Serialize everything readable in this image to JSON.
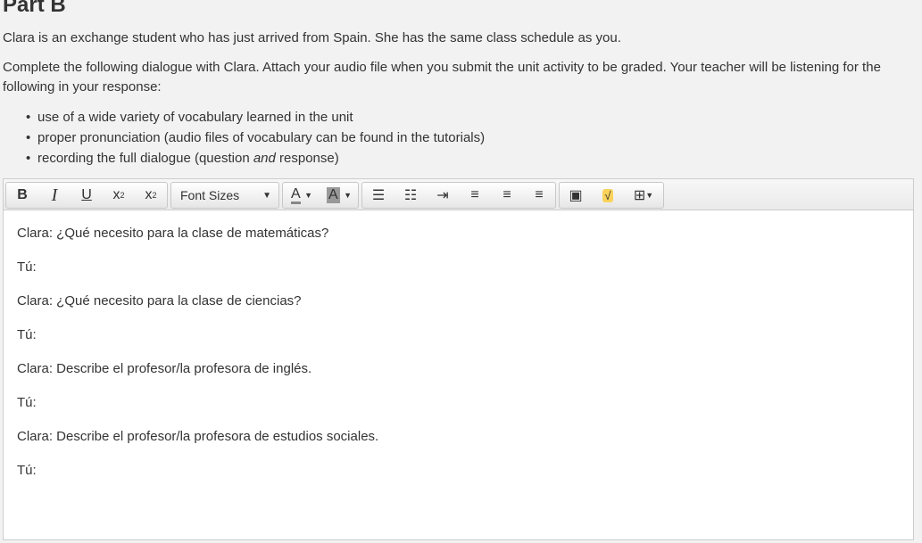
{
  "heading": "Part B",
  "intro": "Clara is an exchange student who has just arrived from Spain. She has the same class schedule as you.",
  "instructions": "Complete the following dialogue with Clara. Attach your audio file when you submit the unit activity to be graded. Your teacher will be listening for the following in your response:",
  "bullets": [
    "use of a wide variety of vocabulary learned in the unit",
    "proper pronunciation (audio files of vocabulary can be found in the tutorials)"
  ],
  "bullet3": {
    "a": "recording the full dialogue (question ",
    "b": "and",
    "c": " response)"
  },
  "toolbar": {
    "font_sizes": "Font Sizes"
  },
  "lines": [
    "Clara: ¿Qué necesito para la clase de matemáticas?",
    "Tú:",
    "Clara: ¿Qué necesito para la clase de ciencias?",
    "Tú:",
    "Clara: Describe el profesor/la profesora de inglés.",
    "Tú:",
    "Clara: Describe el profesor/la profesora de estudios sociales.",
    "Tú:"
  ]
}
